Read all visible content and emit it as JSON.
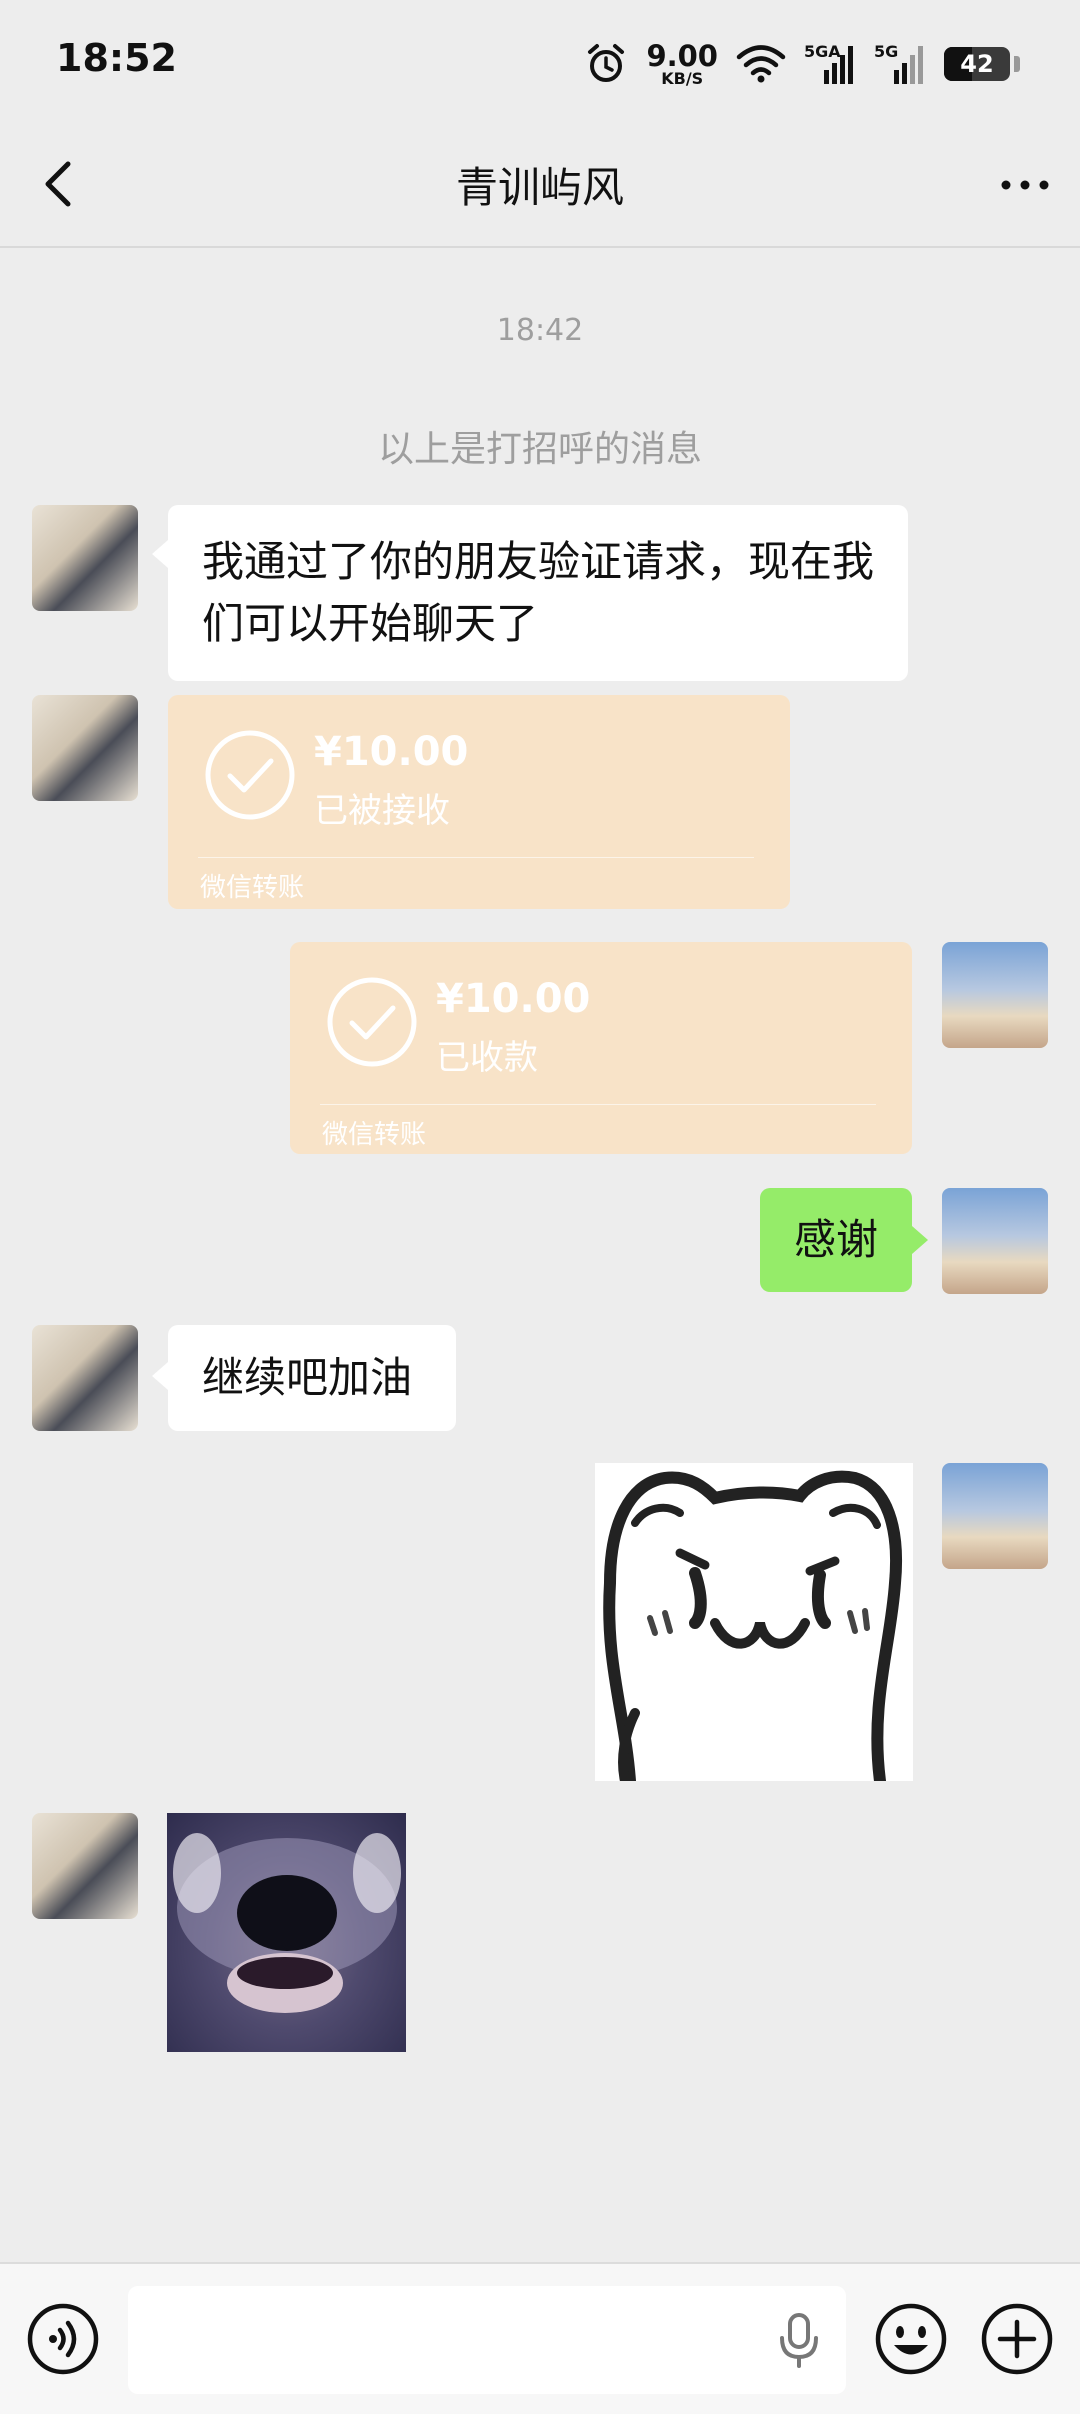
{
  "status_bar": {
    "time": "18:52",
    "net_speed": "9.00",
    "net_unit": "KB/S",
    "signal1_label": "5GA",
    "signal2_label": "5G",
    "battery": "42",
    "battery_level": 0.42
  },
  "header": {
    "title": "青训屿风"
  },
  "chat": {
    "timestamp": "18:42",
    "system_notice": "以上是打招呼的消息",
    "messages": [
      {
        "from": "other",
        "type": "text",
        "text": "我通过了你的朋友验证请求，现在我们可以开始聊天了"
      },
      {
        "from": "other",
        "type": "transfer",
        "amount": "¥10.00",
        "status": "已被接收",
        "source": "微信转账"
      },
      {
        "from": "me",
        "type": "transfer",
        "amount": "¥10.00",
        "status": "已收款",
        "source": "微信转账"
      },
      {
        "from": "me",
        "type": "text",
        "text": "感谢"
      },
      {
        "from": "other",
        "type": "text",
        "text": "继续吧加油"
      },
      {
        "from": "me",
        "type": "sticker",
        "sticker": "cartoon-bear-sticker"
      },
      {
        "from": "other",
        "type": "sticker",
        "sticker": "dog-face-sticker"
      }
    ]
  },
  "input_bar": {
    "placeholder": ""
  },
  "colors": {
    "background": "#ededed",
    "bubble_other": "#ffffff",
    "bubble_me": "#95ec69",
    "transfer_card": "#f8e3c8"
  }
}
